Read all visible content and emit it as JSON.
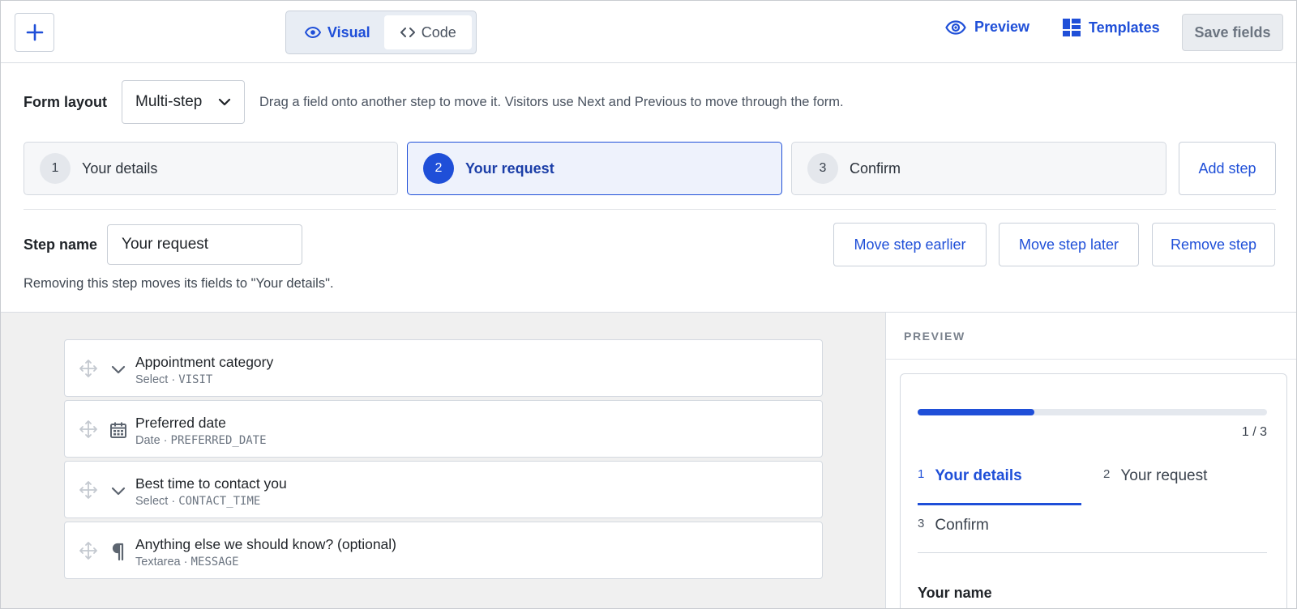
{
  "toolbar": {
    "add_icon": "plus-icon",
    "view_modes": [
      {
        "label": "Visual",
        "icon": "eye-icon",
        "active": true
      },
      {
        "label": "Code",
        "icon": "code-icon",
        "active": false
      }
    ],
    "preview_label": "Preview",
    "templates_label": "Templates",
    "save_label": "Save fields"
  },
  "layout": {
    "label": "Form layout",
    "selected": "Multi-step",
    "hint": "Drag a field onto another step to move it. Visitors use Next and Previous to move through the form."
  },
  "steps": [
    {
      "number": "1",
      "label": "Your details",
      "active": false
    },
    {
      "number": "2",
      "label": "Your request",
      "active": true
    },
    {
      "number": "3",
      "label": "Confirm",
      "active": false
    }
  ],
  "add_step_label": "Add step",
  "step_editor": {
    "name_label": "Step name",
    "name_value": "Your request",
    "move_earlier_label": "Move step earlier",
    "move_later_label": "Move step later",
    "remove_label": "Remove step",
    "remove_note": "Removing this step moves its fields to \"Your details\"."
  },
  "fields": [
    {
      "title": "Appointment category",
      "type": "Select",
      "key": "VISIT",
      "icon": "chevron-down-icon"
    },
    {
      "title": "Preferred date",
      "type": "Date",
      "key": "PREFERRED_DATE",
      "icon": "calendar-icon"
    },
    {
      "title": "Best time to contact you",
      "type": "Select",
      "key": "CONTACT_TIME",
      "icon": "chevron-down-icon"
    },
    {
      "title": "Anything else we should know? (optional)",
      "type": "Textarea",
      "key": "MESSAGE",
      "icon": "pilcrow-icon"
    }
  ],
  "preview": {
    "heading": "PREVIEW",
    "progress_fraction": 0.333,
    "progress_text": "1 / 3",
    "tabs": [
      {
        "number": "1",
        "label": "Your details",
        "active": true
      },
      {
        "number": "2",
        "label": "Your request",
        "active": false
      },
      {
        "number": "3",
        "label": "Confirm",
        "active": false
      }
    ],
    "first_field_label": "Your name"
  },
  "colors": {
    "accent": "#1f4fd8",
    "border": "#d4d9e0",
    "canvas_bg": "#f0f0f0"
  }
}
